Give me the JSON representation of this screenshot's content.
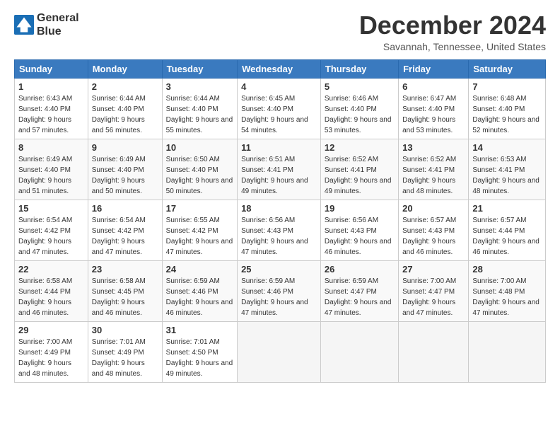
{
  "logo": {
    "line1": "General",
    "line2": "Blue"
  },
  "title": "December 2024",
  "location": "Savannah, Tennessee, United States",
  "headers": [
    "Sunday",
    "Monday",
    "Tuesday",
    "Wednesday",
    "Thursday",
    "Friday",
    "Saturday"
  ],
  "weeks": [
    [
      {
        "day": "1",
        "sunrise": "6:43 AM",
        "sunset": "4:40 PM",
        "daylight": "9 hours and 57 minutes."
      },
      {
        "day": "2",
        "sunrise": "6:44 AM",
        "sunset": "4:40 PM",
        "daylight": "9 hours and 56 minutes."
      },
      {
        "day": "3",
        "sunrise": "6:44 AM",
        "sunset": "4:40 PM",
        "daylight": "9 hours and 55 minutes."
      },
      {
        "day": "4",
        "sunrise": "6:45 AM",
        "sunset": "4:40 PM",
        "daylight": "9 hours and 54 minutes."
      },
      {
        "day": "5",
        "sunrise": "6:46 AM",
        "sunset": "4:40 PM",
        "daylight": "9 hours and 53 minutes."
      },
      {
        "day": "6",
        "sunrise": "6:47 AM",
        "sunset": "4:40 PM",
        "daylight": "9 hours and 53 minutes."
      },
      {
        "day": "7",
        "sunrise": "6:48 AM",
        "sunset": "4:40 PM",
        "daylight": "9 hours and 52 minutes."
      }
    ],
    [
      {
        "day": "8",
        "sunrise": "6:49 AM",
        "sunset": "4:40 PM",
        "daylight": "9 hours and 51 minutes."
      },
      {
        "day": "9",
        "sunrise": "6:49 AM",
        "sunset": "4:40 PM",
        "daylight": "9 hours and 50 minutes."
      },
      {
        "day": "10",
        "sunrise": "6:50 AM",
        "sunset": "4:40 PM",
        "daylight": "9 hours and 50 minutes."
      },
      {
        "day": "11",
        "sunrise": "6:51 AM",
        "sunset": "4:41 PM",
        "daylight": "9 hours and 49 minutes."
      },
      {
        "day": "12",
        "sunrise": "6:52 AM",
        "sunset": "4:41 PM",
        "daylight": "9 hours and 49 minutes."
      },
      {
        "day": "13",
        "sunrise": "6:52 AM",
        "sunset": "4:41 PM",
        "daylight": "9 hours and 48 minutes."
      },
      {
        "day": "14",
        "sunrise": "6:53 AM",
        "sunset": "4:41 PM",
        "daylight": "9 hours and 48 minutes."
      }
    ],
    [
      {
        "day": "15",
        "sunrise": "6:54 AM",
        "sunset": "4:42 PM",
        "daylight": "9 hours and 47 minutes."
      },
      {
        "day": "16",
        "sunrise": "6:54 AM",
        "sunset": "4:42 PM",
        "daylight": "9 hours and 47 minutes."
      },
      {
        "day": "17",
        "sunrise": "6:55 AM",
        "sunset": "4:42 PM",
        "daylight": "9 hours and 47 minutes."
      },
      {
        "day": "18",
        "sunrise": "6:56 AM",
        "sunset": "4:43 PM",
        "daylight": "9 hours and 47 minutes."
      },
      {
        "day": "19",
        "sunrise": "6:56 AM",
        "sunset": "4:43 PM",
        "daylight": "9 hours and 46 minutes."
      },
      {
        "day": "20",
        "sunrise": "6:57 AM",
        "sunset": "4:43 PM",
        "daylight": "9 hours and 46 minutes."
      },
      {
        "day": "21",
        "sunrise": "6:57 AM",
        "sunset": "4:44 PM",
        "daylight": "9 hours and 46 minutes."
      }
    ],
    [
      {
        "day": "22",
        "sunrise": "6:58 AM",
        "sunset": "4:44 PM",
        "daylight": "9 hours and 46 minutes."
      },
      {
        "day": "23",
        "sunrise": "6:58 AM",
        "sunset": "4:45 PM",
        "daylight": "9 hours and 46 minutes."
      },
      {
        "day": "24",
        "sunrise": "6:59 AM",
        "sunset": "4:46 PM",
        "daylight": "9 hours and 46 minutes."
      },
      {
        "day": "25",
        "sunrise": "6:59 AM",
        "sunset": "4:46 PM",
        "daylight": "9 hours and 47 minutes."
      },
      {
        "day": "26",
        "sunrise": "6:59 AM",
        "sunset": "4:47 PM",
        "daylight": "9 hours and 47 minutes."
      },
      {
        "day": "27",
        "sunrise": "7:00 AM",
        "sunset": "4:47 PM",
        "daylight": "9 hours and 47 minutes."
      },
      {
        "day": "28",
        "sunrise": "7:00 AM",
        "sunset": "4:48 PM",
        "daylight": "9 hours and 47 minutes."
      }
    ],
    [
      {
        "day": "29",
        "sunrise": "7:00 AM",
        "sunset": "4:49 PM",
        "daylight": "9 hours and 48 minutes."
      },
      {
        "day": "30",
        "sunrise": "7:01 AM",
        "sunset": "4:49 PM",
        "daylight": "9 hours and 48 minutes."
      },
      {
        "day": "31",
        "sunrise": "7:01 AM",
        "sunset": "4:50 PM",
        "daylight": "9 hours and 49 minutes."
      },
      null,
      null,
      null,
      null
    ]
  ],
  "labels": {
    "sunrise": "Sunrise:",
    "sunset": "Sunset:",
    "daylight": "Daylight:"
  }
}
